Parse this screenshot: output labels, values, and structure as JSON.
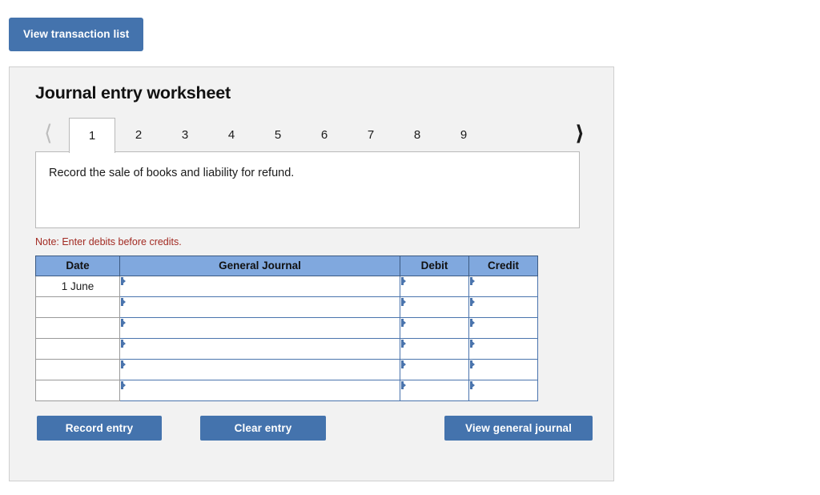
{
  "toolbar": {
    "view_transaction_list_label": "View transaction list"
  },
  "panel": {
    "title": "Journal entry worksheet"
  },
  "tabs": {
    "prev_icon": "chevron-left-icon",
    "next_icon": "chevron-right-icon",
    "active_index": 0,
    "items": [
      {
        "label": "1"
      },
      {
        "label": "2"
      },
      {
        "label": "3"
      },
      {
        "label": "4"
      },
      {
        "label": "5"
      },
      {
        "label": "6"
      },
      {
        "label": "7"
      },
      {
        "label": "8"
      },
      {
        "label": "9"
      }
    ]
  },
  "description": {
    "text": "Record the sale of books and liability for refund."
  },
  "note": {
    "text": "Note: Enter debits before credits."
  },
  "journal": {
    "headers": {
      "date": "Date",
      "general_journal": "General Journal",
      "debit": "Debit",
      "credit": "Credit"
    },
    "rows": [
      {
        "date": "1 June",
        "general_journal": "",
        "debit": "",
        "credit": ""
      },
      {
        "date": "",
        "general_journal": "",
        "debit": "",
        "credit": ""
      },
      {
        "date": "",
        "general_journal": "",
        "debit": "",
        "credit": ""
      },
      {
        "date": "",
        "general_journal": "",
        "debit": "",
        "credit": ""
      },
      {
        "date": "",
        "general_journal": "",
        "debit": "",
        "credit": ""
      },
      {
        "date": "",
        "general_journal": "",
        "debit": "",
        "credit": ""
      }
    ]
  },
  "actions": {
    "record_entry_label": "Record entry",
    "clear_entry_label": "Clear entry",
    "view_general_journal_label": "View general journal"
  },
  "colors": {
    "button_blue": "#4473ad",
    "header_blue": "#80a8de",
    "note_red": "#a22a22",
    "panel_bg": "#f2f2f2",
    "panel_border": "#cfcfcf",
    "cell_outline": "#4a74ad"
  }
}
